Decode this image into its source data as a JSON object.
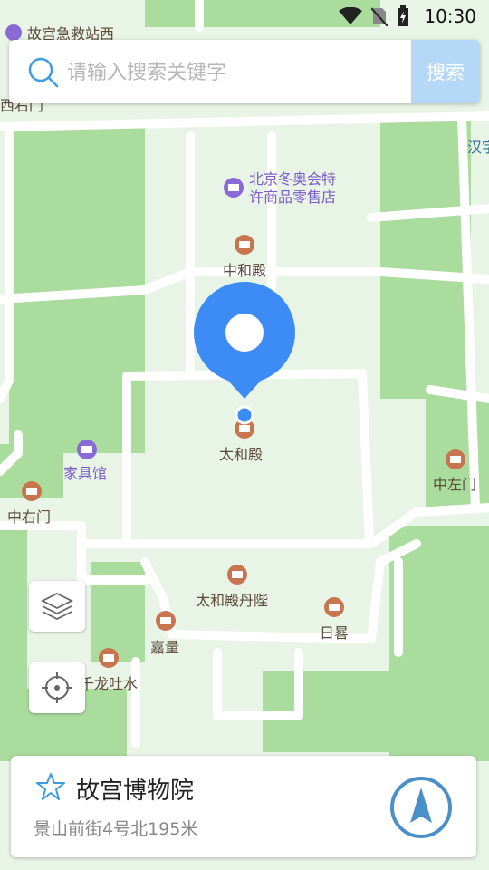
{
  "status_bar": {
    "time": "10:30"
  },
  "search": {
    "placeholder": "请输入搜索关键字",
    "button_label": "搜索"
  },
  "map": {
    "pois": [
      {
        "id": "first-aid",
        "label": "故宫急救站西"
      },
      {
        "id": "xihemen",
        "label": "西右门"
      },
      {
        "id": "hanzi",
        "label": "汉字"
      },
      {
        "id": "winter-olympics-store",
        "label": "北京冬奥会特许商品零售店"
      },
      {
        "id": "zhonghedian",
        "label": "中和殿"
      },
      {
        "id": "taihedian",
        "label": "太和殿"
      },
      {
        "id": "furniture-hall",
        "label": "家具馆"
      },
      {
        "id": "zhongyoumen",
        "label": "中右门"
      },
      {
        "id": "zhongzuomen",
        "label": "中左门"
      },
      {
        "id": "taihedian-danbi",
        "label": "太和殿丹陛"
      },
      {
        "id": "jialiang",
        "label": "嘉量"
      },
      {
        "id": "rigui",
        "label": "日晷"
      },
      {
        "id": "qianlong-tushui",
        "label": "千龙吐水"
      }
    ]
  },
  "selected_place": {
    "name": "故宫博物院",
    "address": "景山前街4号北195米"
  },
  "colors": {
    "accent": "#3d8bf5",
    "poi_brown": "#c8744f",
    "poi_purple": "#8a6bd6",
    "map_green": "#a9dc9d",
    "map_light": "#e8f4e6"
  }
}
